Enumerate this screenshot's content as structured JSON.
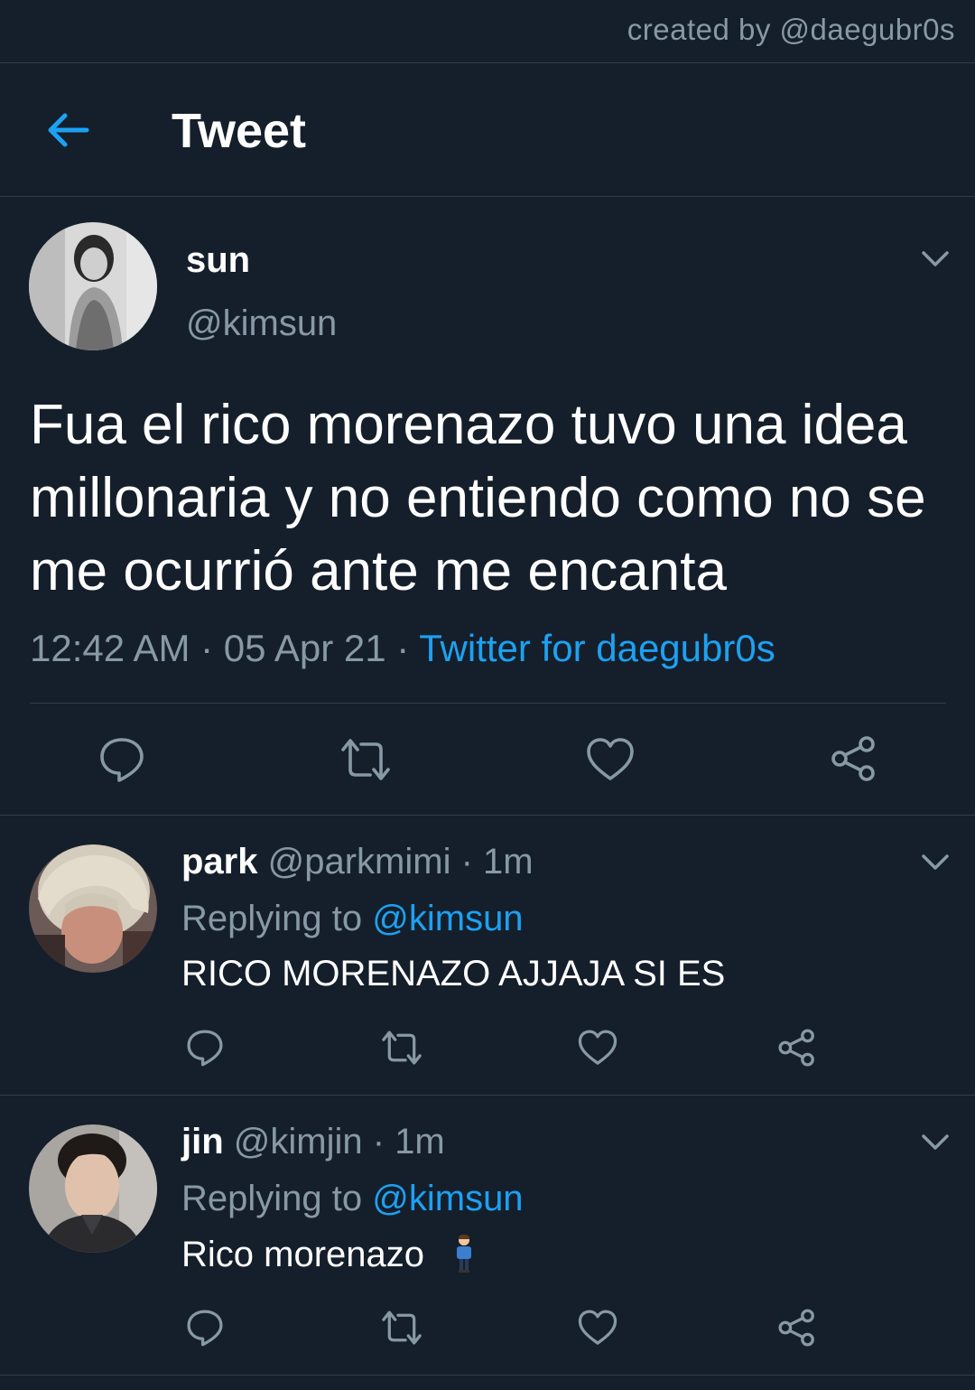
{
  "watermark": "created by @daegubr0s",
  "header": {
    "title": "Tweet"
  },
  "main_tweet": {
    "name": "sun",
    "handle": "@kimsun",
    "text": "Fua el rico morenazo tuvo una idea millonaria y no entiendo como no se me ocurrió ante me encanta",
    "time": "12:42 AM",
    "date": "05 Apr 21",
    "source": "Twitter for daegubr0s"
  },
  "replies": [
    {
      "name": "park",
      "handle": "@parkmimi",
      "age": "1m",
      "replying_prefix": "Replying to",
      "replying_to": "@kimsun",
      "text": "RICO MORENAZO AJJAJA SI ES"
    },
    {
      "name": "jin",
      "handle": "@kimjin",
      "age": "1m",
      "replying_prefix": "Replying to",
      "replying_to": "@kimsun",
      "text": "Rico morenazo"
    }
  ],
  "colors": {
    "background": "#151f2b",
    "accent": "#1da1f2",
    "muted": "#8899a6",
    "divider": "#2f3e4d"
  },
  "icons": [
    "back-arrow-icon",
    "chevron-down-icon",
    "reply-icon",
    "retweet-icon",
    "like-icon",
    "share-icon",
    "person-emoji-icon"
  ]
}
